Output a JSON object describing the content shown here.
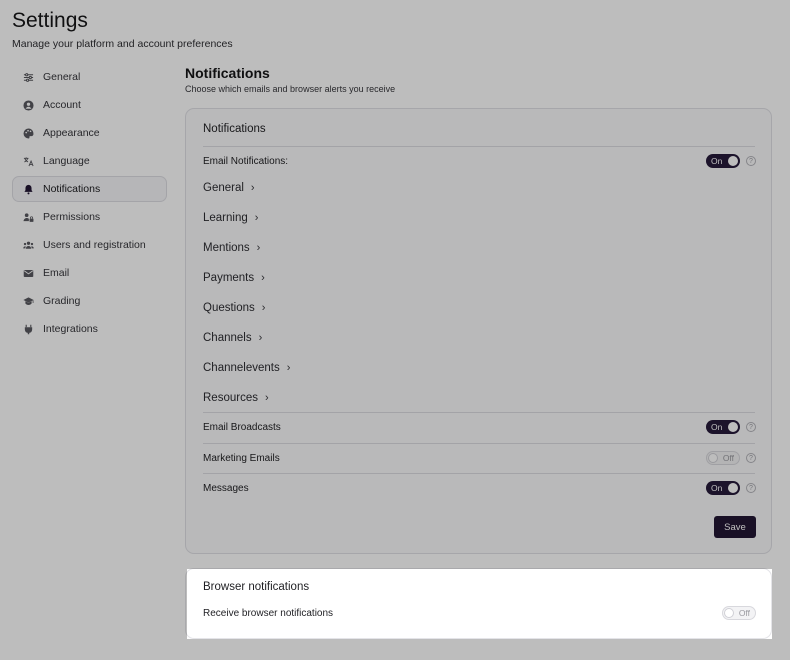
{
  "header": {
    "title": "Settings",
    "subtitle": "Manage your platform and account preferences"
  },
  "sidebar": {
    "items": [
      {
        "label": "General",
        "icon": "sliders-icon"
      },
      {
        "label": "Account",
        "icon": "user-circle-icon"
      },
      {
        "label": "Appearance",
        "icon": "palette-icon"
      },
      {
        "label": "Language",
        "icon": "translate-icon"
      },
      {
        "label": "Notifications",
        "icon": "bell-icon",
        "active": true
      },
      {
        "label": "Permissions",
        "icon": "user-lock-icon"
      },
      {
        "label": "Users and registration",
        "icon": "users-icon"
      },
      {
        "label": "Email",
        "icon": "mail-icon"
      },
      {
        "label": "Grading",
        "icon": "graduation-cap-icon"
      },
      {
        "label": "Integrations",
        "icon": "plug-icon"
      }
    ]
  },
  "main": {
    "title": "Notifications",
    "subtitle": "Choose which emails and browser alerts you receive",
    "card": {
      "title": "Notifications",
      "email_notifications": {
        "label": "Email Notifications:",
        "state": "On"
      },
      "categories": [
        "General",
        "Learning",
        "Mentions",
        "Payments",
        "Questions",
        "Channels",
        "Channelevents",
        "Resources"
      ],
      "email_broadcasts": {
        "label": "Email Broadcasts",
        "state": "On"
      },
      "marketing_emails": {
        "label": "Marketing Emails",
        "state": "Off"
      },
      "messages": {
        "label": "Messages",
        "state": "On"
      },
      "help_glyph": "?",
      "save_label": "Save"
    },
    "browser_card": {
      "title": "Browser notifications",
      "receive": {
        "label": "Receive browser notifications",
        "state": "Off"
      }
    }
  },
  "colors": {
    "accent": "#261a3a",
    "overlay": "rgba(0,0,0,0.26)"
  }
}
